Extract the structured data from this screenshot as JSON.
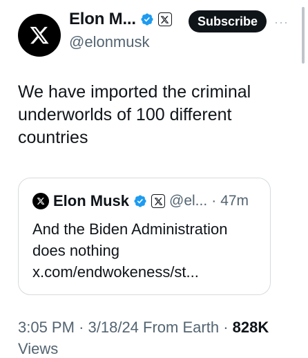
{
  "author": {
    "name": "Elon M...",
    "handle": "@elonmusk"
  },
  "subscribe_label": "Subscribe",
  "more_label": "···",
  "tweet_text": "We have imported the criminal underworlds of 100 different countries",
  "quote": {
    "name": "Elon Musk",
    "handle": "@el...",
    "separator": "·",
    "time": "47m",
    "text": "And the Biden Administration does nothing x.com/endwokeness/st..."
  },
  "meta": {
    "time": "3:05 PM",
    "date": "3/18/24",
    "source": "From Earth",
    "separator": "·",
    "views": "828K",
    "views_label": "Views"
  },
  "colors": {
    "text": "#0f1419",
    "secondary": "#536471",
    "verified": "#1d9bf0",
    "border": "#d6dadd"
  }
}
